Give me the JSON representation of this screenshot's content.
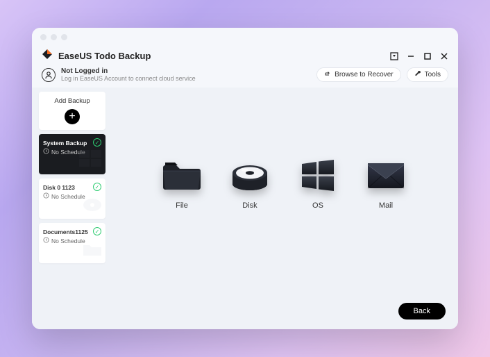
{
  "app": {
    "title": "EaseUS Todo Backup"
  },
  "account": {
    "line1": "Not Logged in",
    "line2": "Log in EaseUS Account to connect cloud service"
  },
  "subbar": {
    "browse": "Browse to Recover",
    "tools": "Tools"
  },
  "sidebar": {
    "add_label": "Add Backup",
    "tasks": [
      {
        "title": "System Backup",
        "schedule": "No Schedule",
        "active": true
      },
      {
        "title": "Disk 0 1123",
        "schedule": "No Schedule",
        "active": false
      },
      {
        "title": "Documents1125",
        "schedule": "No Schedule",
        "active": false
      }
    ]
  },
  "options": {
    "file": "File",
    "disk": "Disk",
    "os": "OS",
    "mail": "Mail"
  },
  "footer": {
    "back": "Back"
  }
}
